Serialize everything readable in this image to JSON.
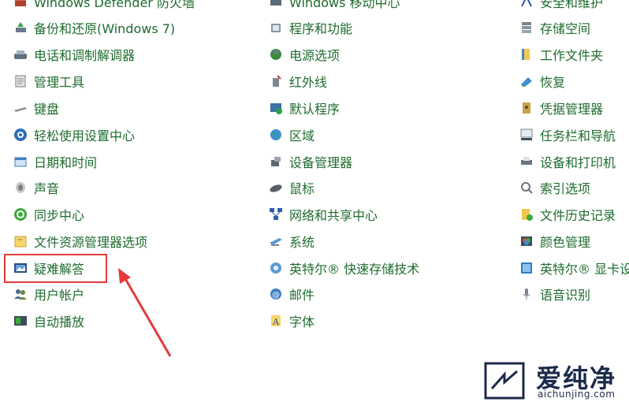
{
  "columns": [
    [
      {
        "label": "Windows Defender 防火墙",
        "icon": "firewall-icon"
      },
      {
        "label": "备份和还原(Windows 7)",
        "icon": "backup-restore-icon"
      },
      {
        "label": "电话和调制解调器",
        "icon": "phone-modem-icon"
      },
      {
        "label": "管理工具",
        "icon": "admin-tools-icon"
      },
      {
        "label": "键盘",
        "icon": "keyboard-icon"
      },
      {
        "label": "轻松使用设置中心",
        "icon": "ease-of-access-icon"
      },
      {
        "label": "日期和时间",
        "icon": "date-time-icon"
      },
      {
        "label": "声音",
        "icon": "sound-icon"
      },
      {
        "label": "同步中心",
        "icon": "sync-center-icon"
      },
      {
        "label": "文件资源管理器选项",
        "icon": "explorer-options-icon"
      },
      {
        "label": "疑难解答",
        "icon": "troubleshooting-icon"
      },
      {
        "label": "用户帐户",
        "icon": "user-accounts-icon"
      },
      {
        "label": "自动播放",
        "icon": "autoplay-icon"
      }
    ],
    [
      {
        "label": "Windows 移动中心",
        "icon": "mobility-center-icon"
      },
      {
        "label": "程序和功能",
        "icon": "programs-features-icon"
      },
      {
        "label": "电源选项",
        "icon": "power-options-icon"
      },
      {
        "label": "红外线",
        "icon": "infrared-icon"
      },
      {
        "label": "默认程序",
        "icon": "default-programs-icon"
      },
      {
        "label": "区域",
        "icon": "region-icon"
      },
      {
        "label": "设备管理器",
        "icon": "device-manager-icon"
      },
      {
        "label": "鼠标",
        "icon": "mouse-icon"
      },
      {
        "label": "网络和共享中心",
        "icon": "network-sharing-icon"
      },
      {
        "label": "系统",
        "icon": "system-icon"
      },
      {
        "label": "英特尔® 快速存储技术",
        "icon": "intel-rst-icon"
      },
      {
        "label": "邮件",
        "icon": "mail-icon"
      },
      {
        "label": "字体",
        "icon": "fonts-icon"
      }
    ],
    [
      {
        "label": "安全和维护",
        "icon": "security-maintenance-icon"
      },
      {
        "label": "存储空间",
        "icon": "storage-spaces-icon"
      },
      {
        "label": "工作文件夹",
        "icon": "work-folders-icon"
      },
      {
        "label": "恢复",
        "icon": "recovery-icon"
      },
      {
        "label": "凭据管理器",
        "icon": "credential-manager-icon"
      },
      {
        "label": "任务栏和导航",
        "icon": "taskbar-navigation-icon"
      },
      {
        "label": "设备和打印机",
        "icon": "devices-printers-icon"
      },
      {
        "label": "索引选项",
        "icon": "indexing-options-icon"
      },
      {
        "label": "文件历史记录",
        "icon": "file-history-icon"
      },
      {
        "label": "颜色管理",
        "icon": "color-management-icon"
      },
      {
        "label": "英特尔® 显卡设",
        "icon": "intel-graphics-icon"
      },
      {
        "label": "语音识别",
        "icon": "speech-recognition-icon"
      }
    ]
  ],
  "watermark": {
    "cn": "爱纯净",
    "en": "aichunjing.com",
    "icon": "watermark-logo-icon"
  },
  "colors": {
    "link": "#1e6b2e",
    "highlight": "#e53a3a",
    "watermark": "#1c2a4a"
  }
}
